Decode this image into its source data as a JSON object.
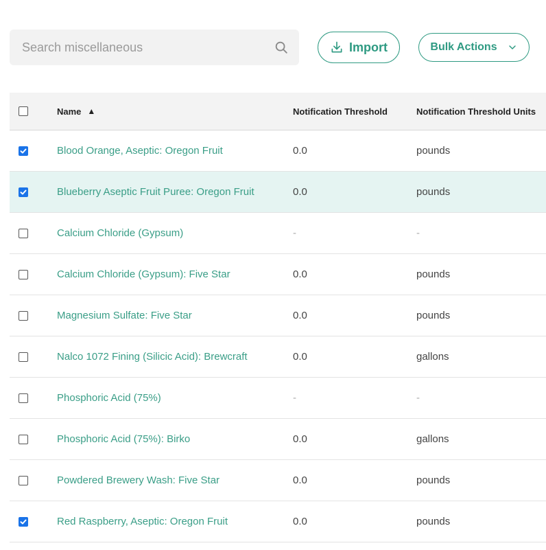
{
  "search": {
    "placeholder": "Search miscellaneous",
    "value": ""
  },
  "toolbar": {
    "import_label": "Import",
    "bulk_label": "Bulk Actions"
  },
  "colors": {
    "accent": "#2e9a82",
    "link": "#3a9e87",
    "highlight_row": "#e5f4f2",
    "checkbox_checked": "#1a73e8"
  },
  "table": {
    "headers": {
      "name": "Name",
      "threshold": "Notification Threshold",
      "units": "Notification Threshold Units"
    },
    "sort": {
      "column": "name",
      "indicator": "▲"
    },
    "rows": [
      {
        "checked": true,
        "name": "Blood Orange, Aseptic: Oregon Fruit",
        "threshold": "0.0",
        "units": "pounds"
      },
      {
        "checked": true,
        "name": "Blueberry Aseptic Fruit Puree: Oregon Fruit",
        "threshold": "0.0",
        "units": "pounds",
        "highlight": true
      },
      {
        "checked": false,
        "name": "Calcium Chloride (Gypsum)",
        "threshold": "-",
        "units": "-"
      },
      {
        "checked": false,
        "name": "Calcium Chloride (Gypsum): Five Star",
        "threshold": "0.0",
        "units": "pounds"
      },
      {
        "checked": false,
        "name": "Magnesium Sulfate: Five Star",
        "threshold": "0.0",
        "units": "pounds"
      },
      {
        "checked": false,
        "name": "Nalco 1072 Fining (Silicic Acid): Brewcraft",
        "threshold": "0.0",
        "units": "gallons"
      },
      {
        "checked": false,
        "name": "Phosphoric Acid (75%)",
        "threshold": "-",
        "units": "-"
      },
      {
        "checked": false,
        "name": "Phosphoric Acid (75%): Birko",
        "threshold": "0.0",
        "units": "gallons"
      },
      {
        "checked": false,
        "name": "Powdered Brewery Wash: Five Star",
        "threshold": "0.0",
        "units": "pounds"
      },
      {
        "checked": true,
        "name": "Red Raspberry, Aseptic: Oregon Fruit",
        "threshold": "0.0",
        "units": "pounds"
      }
    ]
  }
}
